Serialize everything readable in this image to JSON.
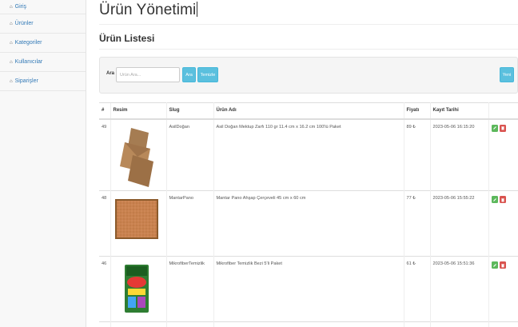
{
  "sidebar": {
    "items": [
      {
        "label": "Giriş",
        "icon": "home-icon"
      },
      {
        "label": "Ürünler",
        "icon": "home-icon"
      },
      {
        "label": "Kategoriler",
        "icon": "home-icon"
      },
      {
        "label": "Kullanıcılar",
        "icon": "home-icon"
      },
      {
        "label": "Siparişler",
        "icon": "home-icon"
      }
    ]
  },
  "page": {
    "title": "Ürün Yönetimi",
    "section_title": "Ürün Listesi"
  },
  "search": {
    "label": "Ara",
    "placeholder": "Ürün Ara...",
    "search_button": "Ara",
    "clear_button": "Temizle",
    "new_button": "Yeni"
  },
  "table": {
    "headers": {
      "id": "#",
      "image": "Resim",
      "slug": "Slug",
      "name": "Ürün Adı",
      "price": "Fiyatı",
      "date": "Kayıt Tarihi"
    },
    "rows": [
      {
        "id": "49",
        "image": "envelope",
        "slug": "AsilDoğan",
        "name": "Asil Doğan Mektup Zarfı 110 gr 11.4 cm x 16.2 cm 100'lü Paket",
        "price": "89 ₺",
        "date": "2023-05-06 16:15:20"
      },
      {
        "id": "48",
        "image": "cork-board",
        "slug": "MantarPano",
        "name": "Mantar Pano Ahşap Çerçeveli 45 cm x 60 cm",
        "price": "77 ₺",
        "date": "2023-05-06 15:55:22"
      },
      {
        "id": "46",
        "image": "microfiber-cloth",
        "slug": "MikrofiberTemizlik",
        "name": "Mikrofiber Temizlik Bezi 5'li Paket",
        "price": "61 ₺",
        "date": "2023-05-06 15:51:36"
      }
    ]
  },
  "colors": {
    "link": "#337ab7",
    "info_button": "#5bc0de",
    "edit_button": "#5cb85c",
    "delete_button": "#d9534f"
  }
}
